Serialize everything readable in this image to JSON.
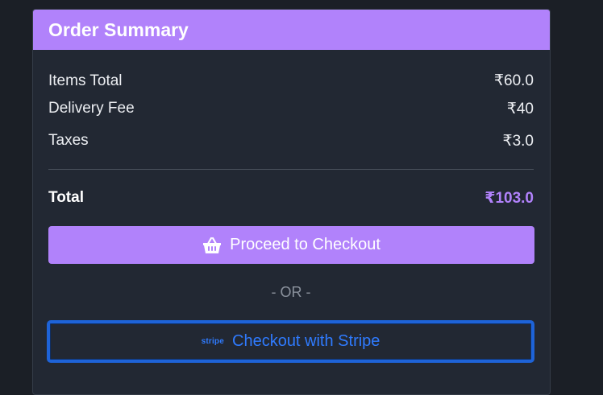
{
  "summary": {
    "title": "Order Summary",
    "rows": [
      {
        "label": "Items Total",
        "value": "₹60.0"
      },
      {
        "label": "Delivery Fee",
        "value": "₹40"
      },
      {
        "label": "Taxes",
        "value": "₹3.0"
      }
    ],
    "total": {
      "label": "Total",
      "value": "₹103.0"
    }
  },
  "actions": {
    "checkout_label": "Proceed to Checkout",
    "checkout_icon": "basket-icon",
    "or_label": "- OR -",
    "stripe_logo": "stripe",
    "stripe_label": "Checkout with Stripe"
  },
  "colors": {
    "accent": "#b182fb",
    "stripe_blue": "#2f7bff",
    "background": "#1b1f26",
    "card": "#222833"
  }
}
